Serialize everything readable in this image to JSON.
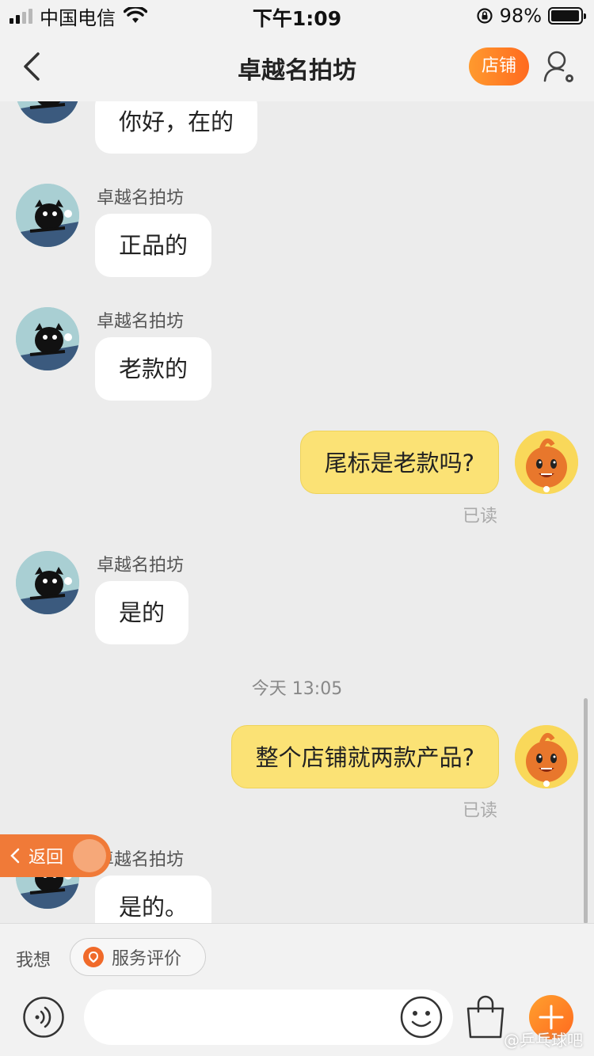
{
  "status_bar": {
    "carrier": "中国电信",
    "time": "下午1:09",
    "battery_percent": "98%",
    "battery_level": 0.98,
    "signal_bars": 2
  },
  "header": {
    "title": "卓越名拍坊",
    "shop_button": "店铺"
  },
  "chat": {
    "messages": [
      {
        "side": "left",
        "sender": "",
        "text": "你好，在的"
      },
      {
        "side": "left",
        "sender": "卓越名拍坊",
        "text": "正品的"
      },
      {
        "side": "left",
        "sender": "卓越名拍坊",
        "text": "老款的"
      },
      {
        "side": "right",
        "text": "尾标是老款吗?",
        "status": "已读"
      },
      {
        "side": "left",
        "sender": "卓越名拍坊",
        "text": "是的"
      },
      {
        "side": "right",
        "text": "整个店铺就两款产品?",
        "status": "已读"
      },
      {
        "side": "left",
        "sender": "卓越名拍坊",
        "text": "是的。"
      }
    ],
    "timestamp": "今天 13:05"
  },
  "floating_back": {
    "label": "返回"
  },
  "quick_bar": {
    "label": "我想",
    "chips": [
      "服务评价"
    ]
  },
  "input_bar": {
    "placeholder": "",
    "watermark": "@乒乓球吧"
  },
  "colors": {
    "accent_orange": "#ff7a22",
    "my_bubble": "#fbe275",
    "their_bubble": "#ffffff",
    "background": "#ececec"
  }
}
